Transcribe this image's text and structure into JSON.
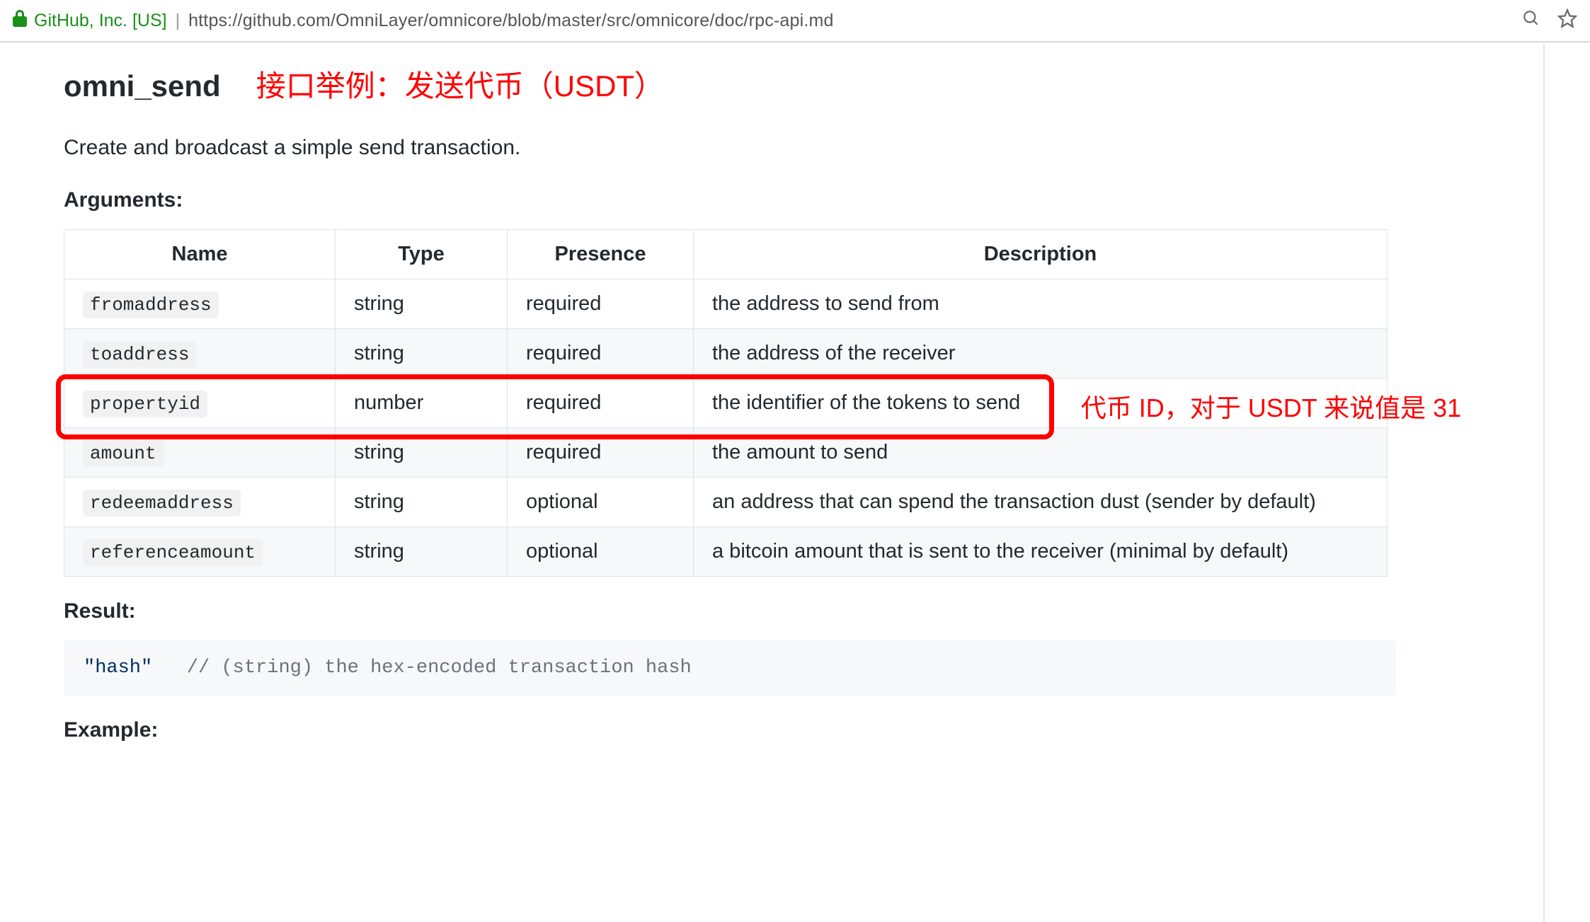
{
  "browser": {
    "cert_name": "GitHub, Inc. [US]",
    "url": "https://github.com/OmniLayer/omnicore/blob/master/src/omnicore/doc/rpc-api.md",
    "icons": {
      "lock": "lock-icon",
      "zoom": "🔍",
      "star": "☆"
    }
  },
  "doc": {
    "api_name": "omni_send",
    "title_annotation": "接口举例：发送代币（USDT）",
    "lead": "Create and broadcast a simple send transaction.",
    "arguments_heading": "Arguments:",
    "table_headers": {
      "name": "Name",
      "type": "Type",
      "presence": "Presence",
      "description": "Description"
    },
    "args": [
      {
        "name": "fromaddress",
        "type": "string",
        "presence": "required",
        "description": "the address to send from"
      },
      {
        "name": "toaddress",
        "type": "string",
        "presence": "required",
        "description": "the address of the receiver"
      },
      {
        "name": "propertyid",
        "type": "number",
        "presence": "required",
        "description": "the identifier of the tokens to send"
      },
      {
        "name": "amount",
        "type": "string",
        "presence": "required",
        "description": "the amount to send"
      },
      {
        "name": "redeemaddress",
        "type": "string",
        "presence": "optional",
        "description": "an address that can spend the transaction dust (sender by default)"
      },
      {
        "name": "referenceamount",
        "type": "string",
        "presence": "optional",
        "description": "a bitcoin amount that is sent to the receiver (minimal by default)"
      }
    ],
    "highlight_row_index": 2,
    "highlight_note": "代币 ID，对于 USDT 来说值是 31",
    "result_heading": "Result:",
    "result_code": {
      "str": "\"hash\"",
      "comment": "// (string) the hex-encoded transaction hash"
    },
    "example_heading": "Example:"
  }
}
